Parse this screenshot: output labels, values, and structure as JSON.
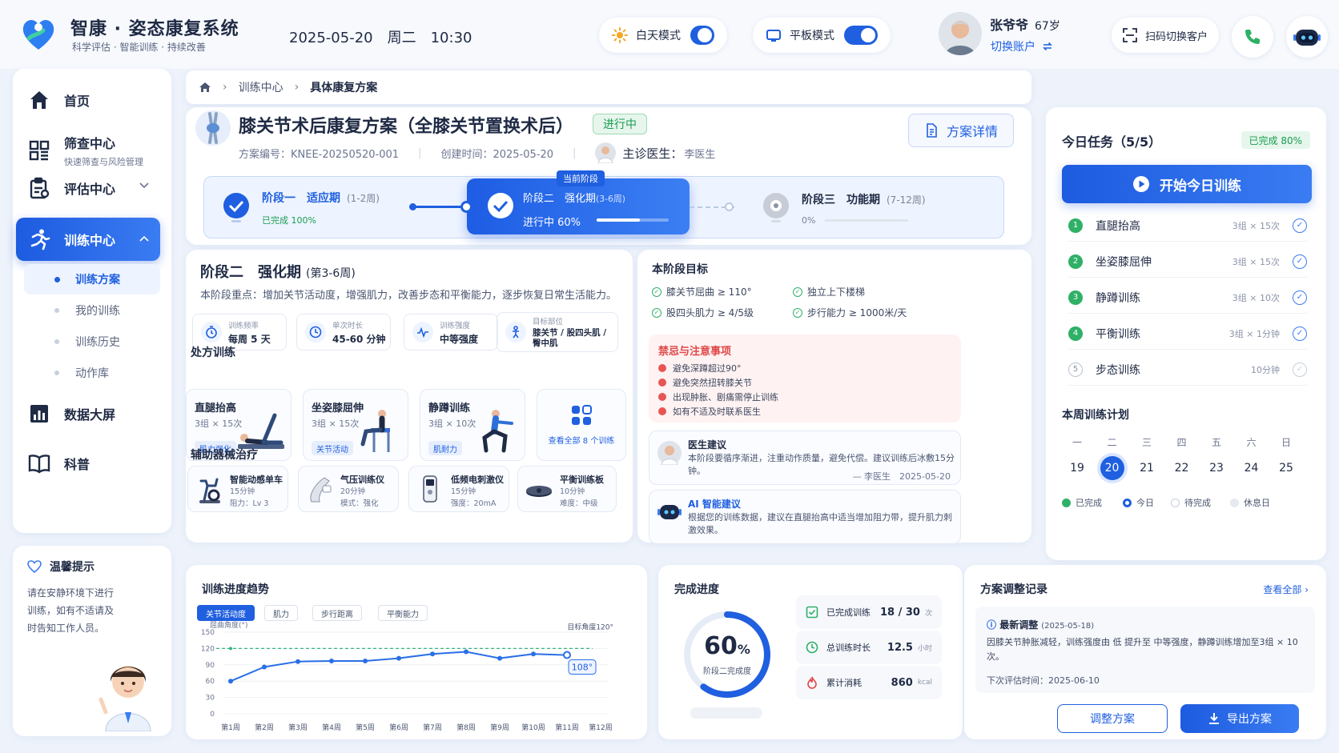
{
  "header": {
    "app_title": "智康 · 姿态康复系统",
    "app_subtitle": "科学评估 · 智能训练 · 持续改善",
    "date": "2025-05-20",
    "weekday": "周二",
    "time": "10:30",
    "day_mode_label": "白天模式",
    "tablet_mode_label": "平板模式",
    "user_name": "张爷爷",
    "user_age": "67岁",
    "switch_account": "切换账户",
    "scan_label": "扫码切换客户"
  },
  "sidebar": {
    "items": [
      {
        "label": "首页",
        "icon": "home-icon"
      },
      {
        "label": "筛查中心",
        "sub": "快速筛查与风险管理",
        "icon": "grid-icon"
      },
      {
        "label": "评估中心",
        "icon": "clipboard-icon"
      },
      {
        "label": "训练中心",
        "icon": "run-icon"
      },
      {
        "label": "数据大屏",
        "icon": "chart-icon"
      },
      {
        "label": "科普",
        "icon": "book-icon"
      }
    ],
    "sub_items": [
      "训练方案",
      "我的训练",
      "训练历史",
      "动作库"
    ],
    "tips_title": "温馨提示",
    "tips_text": "请在安静环境下进行训练，如有不适请及时告知工作人员。"
  },
  "breadcrumb": [
    "训练中心",
    "具体康复方案"
  ],
  "plan": {
    "title": "膝关节术后康复方案（全膝关节置换术后）",
    "status": "进行中",
    "code_label": "方案编号：KNEE-20250520-001",
    "created_label": "创建时间：2025-05-20",
    "doctor_label": "主诊医生：",
    "doctor_name": "李医生",
    "detail_button": "方案详情",
    "current_stage_tag": "当前阶段",
    "stages": [
      {
        "name": "阶段一　适应期",
        "range": "(1-2周)",
        "status": "已完成 100%",
        "progress": 1.0
      },
      {
        "name": "阶段二　强化期",
        "range": "(3-6周)",
        "status": "进行中 60%",
        "progress": 0.6
      },
      {
        "name": "阶段三　功能期",
        "range": "(7-12周)",
        "status": "0%",
        "progress": 0.0
      }
    ]
  },
  "stage_detail": {
    "title": "阶段二　强化期",
    "range": "(第3-6周)",
    "focus": "本阶段重点：增加关节活动度，增强肌力，改善步态和平衡能力，逐步恢复日常生活能力。",
    "metrics": [
      {
        "label": "训练频率",
        "value": "每周 5 天"
      },
      {
        "label": "单次时长",
        "value": "45-60 分钟"
      },
      {
        "label": "训练强度",
        "value": "中等强度"
      },
      {
        "label": "目标部位",
        "value": "膝关节 / 股四头肌 / 臀中肌"
      }
    ],
    "prescription_label": "处方训练",
    "exercises": [
      {
        "name": "直腿抬高",
        "dose": "3组 × 15次",
        "tag": "肌力强化"
      },
      {
        "name": "坐姿膝屈伸",
        "dose": "3组 × 15次",
        "tag": "关节活动"
      },
      {
        "name": "静蹲训练",
        "dose": "3组 × 10次",
        "tag": "肌耐力"
      }
    ],
    "view_all": "查看全部 8 个训练",
    "device_label": "辅助器械治疗",
    "devices": [
      {
        "name": "智能动感单车",
        "l1": "15分钟",
        "l2": "阻力：Lv 3"
      },
      {
        "name": "气压训练仪",
        "l1": "20分钟",
        "l2": "模式：强化"
      },
      {
        "name": "低频电刺激仪",
        "l1": "15分钟",
        "l2": "强度：20mA"
      },
      {
        "name": "平衡训练板",
        "l1": "10分钟",
        "l2": "难度：中级"
      }
    ]
  },
  "goals": {
    "title": "本阶段目标",
    "items": [
      "膝关节屈曲 ≥ 110°",
      "独立上下楼梯",
      "股四头肌力 ≥ 4/5级",
      "步行能力 ≥ 1000米/天"
    ],
    "warn_title": "禁忌与注意事项",
    "warnings": [
      "避免深蹲超过90°",
      "避免突然扭转膝关节",
      "出现肿胀、剧痛需停止训练",
      "如有不适及时联系医生"
    ],
    "doctor_title": "医生建议",
    "doctor_text": "本阶段要循序渐进，注重动作质量，避免代偿。建议训练后冰敷15分钟。",
    "doctor_sign": "— 李医生　2025-05-20",
    "ai_title": "AI 智能建议",
    "ai_text": "根据您的训练数据，建议在直腿抬高中适当增加阻力带，提升肌力刺激效果。"
  },
  "today": {
    "title": "今日任务（5/5）",
    "done": "已完成 80%",
    "start_button": "开始今日训练",
    "tasks": [
      {
        "no": "1",
        "name": "直腿抬高",
        "dose": "3组 × 15次",
        "done": true
      },
      {
        "no": "2",
        "name": "坐姿膝屈伸",
        "dose": "3组 × 15次",
        "done": true
      },
      {
        "no": "3",
        "name": "静蹲训练",
        "dose": "3组 × 10次",
        "done": true
      },
      {
        "no": "4",
        "name": "平衡训练",
        "dose": "3组 × 1分钟",
        "done": true
      },
      {
        "no": "5",
        "name": "步态训练",
        "dose": "10分钟",
        "done": false
      }
    ],
    "week_title": "本周训练计划",
    "weekdays": [
      "一",
      "二",
      "三",
      "四",
      "五",
      "六",
      "日"
    ],
    "dates": [
      "19",
      "20",
      "21",
      "22",
      "23",
      "24",
      "25"
    ],
    "legend": [
      "已完成",
      "今日",
      "待完成",
      "休息日"
    ]
  },
  "trend": {
    "title": "训练进度趋势",
    "tabs": [
      "关节活动度",
      "肌力",
      "步行距离",
      "平衡能力"
    ],
    "y_label": "屈曲角度(°)",
    "target_label": "目标角度120°",
    "end_label": "108°"
  },
  "chart_data": {
    "type": "line",
    "x": [
      "第1周",
      "第2周",
      "第3周",
      "第4周",
      "第5周",
      "第6周",
      "第7周",
      "第8周",
      "第9周",
      "第10周",
      "第11周",
      "第12周"
    ],
    "series": [
      {
        "values": [
          60,
          86,
          96,
          97,
          97,
          102,
          110,
          114,
          102,
          110,
          108
        ]
      }
    ],
    "target": 120,
    "ylim": [
      0,
      150
    ],
    "yticks": [
      0,
      30,
      60,
      90,
      120,
      150
    ]
  },
  "progress": {
    "title": "完成进度",
    "percent": 60,
    "percent_unit": "%",
    "ring_label": "阶段二完成度",
    "stats": [
      {
        "label": "已完成训练",
        "value": "18 / 30",
        "unit": "次"
      },
      {
        "label": "总训练时长",
        "value": "12.5",
        "unit": "小时"
      },
      {
        "label": "累计消耗",
        "value": "860",
        "unit": "kcal"
      }
    ]
  },
  "adjust": {
    "title": "方案调整记录",
    "view_all": "查看全部",
    "latest_title": "最新调整",
    "latest_date": "(2025-05-18)",
    "latest_text": "因膝关节肿胀减轻，训练强度由 低 提升至 中等强度，静蹲训练增加至3组 × 10次。",
    "next_eval": "下次评估时间：2025-06-10",
    "adjust_button": "调整方案",
    "export_button": "导出方案"
  },
  "colors": {
    "primary": "#1f5fe0",
    "success": "#2fb067",
    "danger": "#e04848"
  }
}
